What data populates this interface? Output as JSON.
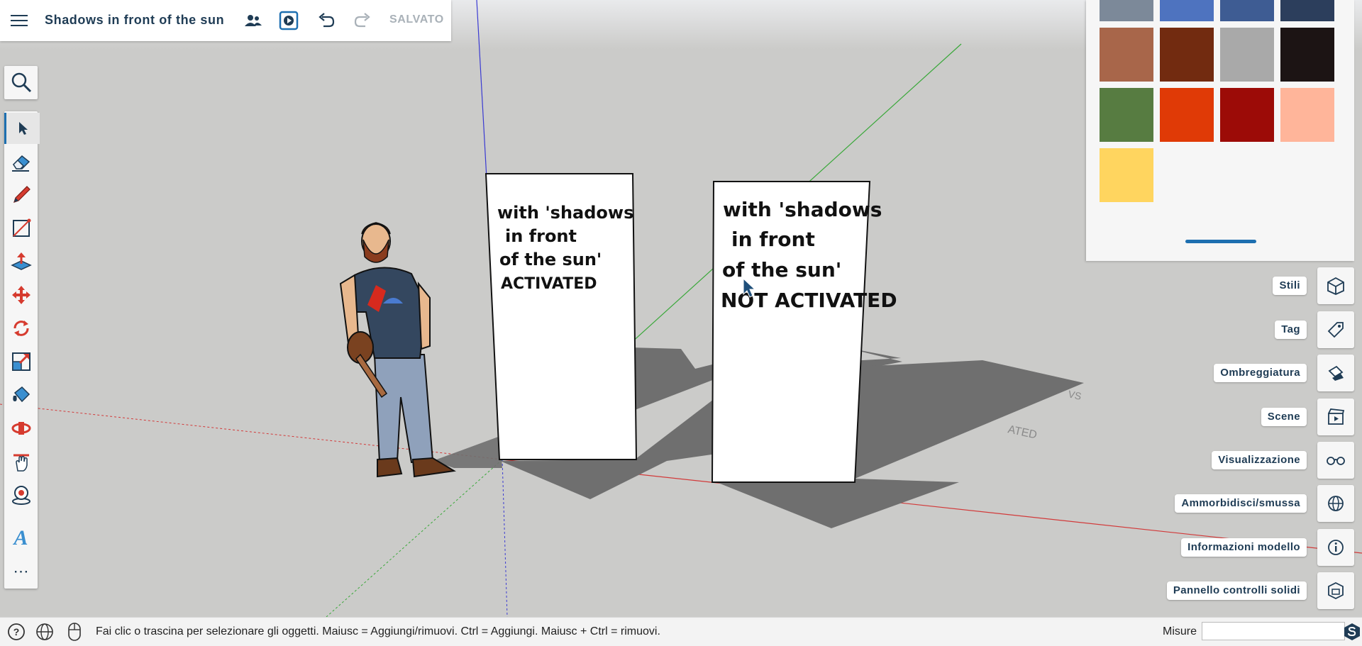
{
  "header": {
    "document_title": "Shadows in front of the sun",
    "save_status": "SALVATO",
    "icons": [
      "hamburger-menu-icon",
      "users-icon",
      "play-scene-icon",
      "undo-icon",
      "redo-icon"
    ]
  },
  "left_toolbar": {
    "tools": [
      "search",
      "select",
      "eraser",
      "pencil",
      "rectangle",
      "push-pull",
      "move",
      "rotate",
      "scale",
      "paint-bucket",
      "orbit",
      "pan",
      "position-camera",
      "text",
      "more"
    ],
    "more_label": "⋯",
    "text_tool_glyph": "A"
  },
  "color_panel": {
    "swatches": [
      "#7c8999",
      "#4e73bf",
      "#3e5c93",
      "#2c3e5c",
      "#a8664a",
      "#722b10",
      "#a9a9a9",
      "#1c1414",
      "#577c41",
      "#e03a06",
      "#9c0b07",
      "#ffb59a",
      "#ffd55f"
    ]
  },
  "viewport": {
    "sign_left": [
      "with 'shadows",
      "in front",
      "of the sun'",
      "ACTIVATED"
    ],
    "sign_right": [
      "with 'shadows",
      "in front",
      "of the sun'",
      "NOT ACTIVATED"
    ],
    "shadow_text_fragments": [
      "VS",
      "ATED"
    ],
    "colors": {
      "background": "#cbcbc9",
      "shadow": "#6f6f6f",
      "red_axis": "#d23a3a",
      "green_axis": "#3aa83a",
      "blue_axis": "#3a3ad2"
    }
  },
  "right_trays": [
    {
      "label": "Stili",
      "icon": "styles-icon"
    },
    {
      "label": "Tag",
      "icon": "tag-icon"
    },
    {
      "label": "Ombreggiatura",
      "icon": "shadows-icon"
    },
    {
      "label": "Scene",
      "icon": "scenes-icon"
    },
    {
      "label": "Visualizzazione",
      "icon": "display-glasses-icon"
    },
    {
      "label": "Ammorbidisci/smussa",
      "icon": "soften-globe-icon"
    },
    {
      "label": "Informazioni modello",
      "icon": "info-icon"
    },
    {
      "label": "Pannello controlli solidi",
      "icon": "solid-inspector-icon"
    }
  ],
  "status_bar": {
    "hint": "Fai clic o trascina per selezionare gli oggetti. Maiusc = Aggiungi/rimuovi. Ctrl = Aggiungi. Maiusc + Ctrl = rimuovi.",
    "measure_label": "Misure",
    "measure_value": ""
  },
  "accent_color": "#1d6fb0"
}
